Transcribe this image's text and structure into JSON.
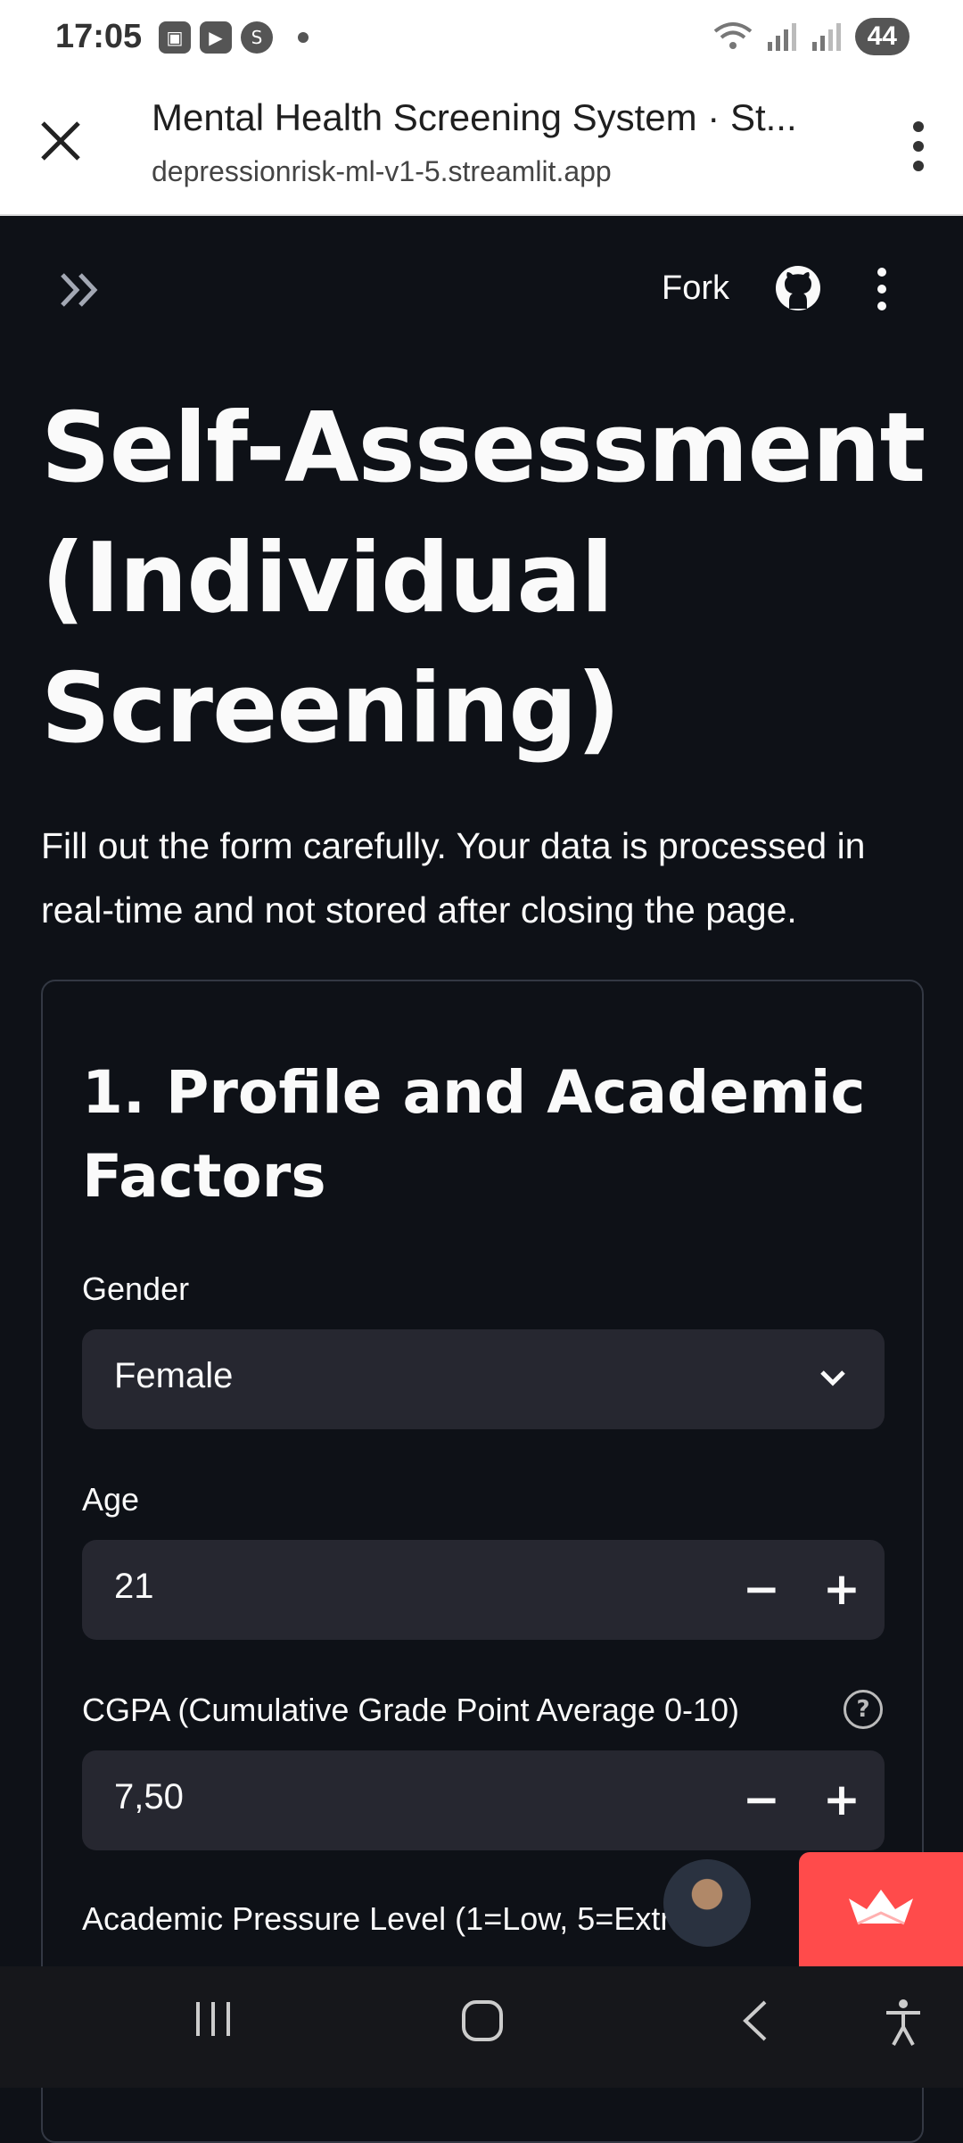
{
  "status_bar": {
    "time": "17:05",
    "battery": "44",
    "icons": [
      "screenshot-icon",
      "youtube-icon",
      "s-app-icon",
      "wifi-icon",
      "signal-icon",
      "signal-icon"
    ]
  },
  "browser": {
    "title": "Mental Health Screening System · St...",
    "url": "depressionrisk-ml-v1-5.streamlit.app"
  },
  "app_header": {
    "fork_label": "Fork"
  },
  "page": {
    "title": "Self-Assessment (Individual Screening)",
    "intro": "Fill out the form carefully. Your data is processed in real-time and not stored after closing the page."
  },
  "form": {
    "section_title": "1. Profile and Academic Factors",
    "gender": {
      "label": "Gender",
      "value": "Female"
    },
    "age": {
      "label": "Age",
      "value": "21",
      "minus": "−",
      "plus": "+"
    },
    "cgpa": {
      "label": "CGPA (Cumulative Grade Point Average 0-10)",
      "value": "7,50",
      "help": "?",
      "minus": "−",
      "plus": "+"
    },
    "pressure": {
      "label": "Academic Pressure Level (1=Low, 5=Extre"
    }
  },
  "colors": {
    "background": "#0e1117",
    "field": "#262730",
    "accent": "#ff4b4b"
  }
}
